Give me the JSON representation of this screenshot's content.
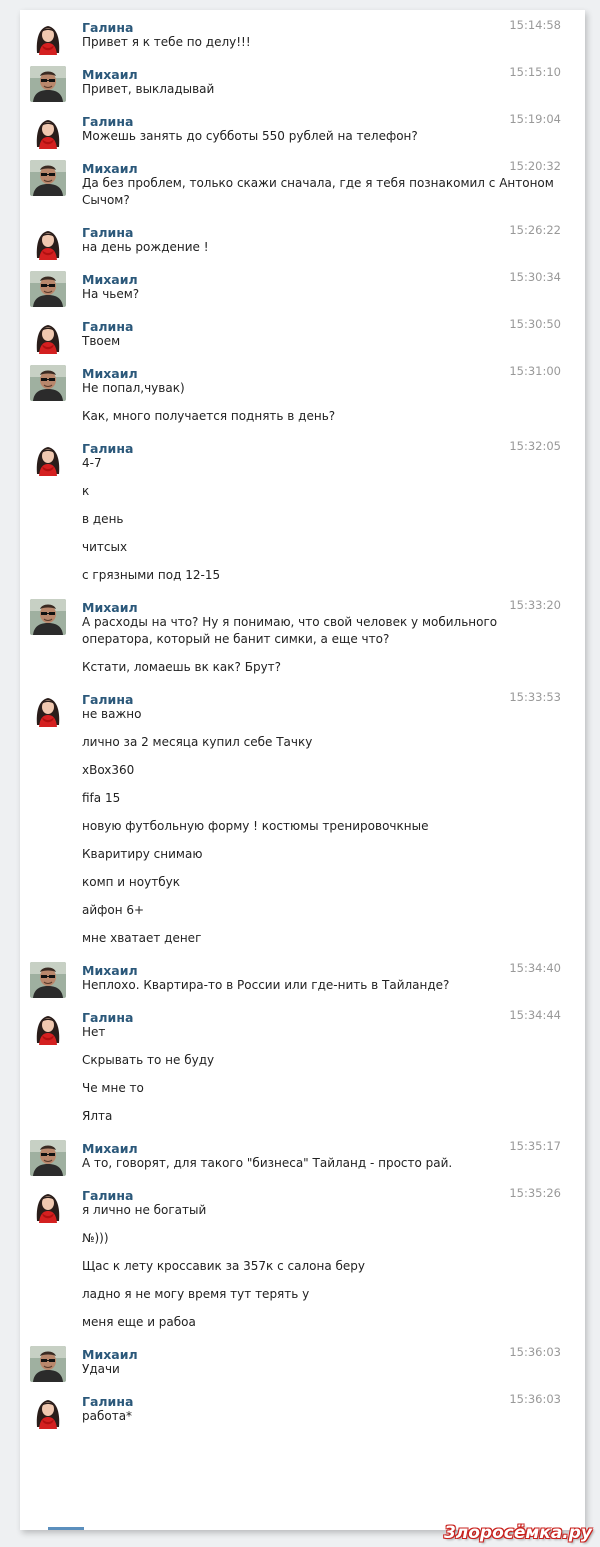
{
  "watermark": "3лорoсёмка.ру",
  "messages": [
    {
      "author": "Галина",
      "avatar": "galina",
      "time": "15:14:58",
      "lines": [
        "Привет я к тебе по делу!!!"
      ]
    },
    {
      "author": "Михаил",
      "avatar": "mikhail",
      "time": "15:15:10",
      "lines": [
        "Привет, выкладывай"
      ]
    },
    {
      "author": "Галина",
      "avatar": "galina",
      "time": "15:19:04",
      "lines": [
        "Можешь занять до субботы 550 рублей на телефон?"
      ]
    },
    {
      "author": "Михаил",
      "avatar": "mikhail",
      "time": "15:20:32",
      "lines": [
        "Да без проблем, только скажи сначала, где я тебя познакомил с Антоном Сычом?"
      ]
    },
    {
      "author": "Галина",
      "avatar": "galina",
      "time": "15:26:22",
      "lines": [
        "на день рождение !"
      ]
    },
    {
      "author": "Михаил",
      "avatar": "mikhail",
      "time": "15:30:34",
      "lines": [
        "На чьем?"
      ]
    },
    {
      "author": "Галина",
      "avatar": "galina",
      "time": "15:30:50",
      "lines": [
        "Твоем"
      ]
    },
    {
      "author": "Михаил",
      "avatar": "mikhail",
      "time": "15:31:00",
      "lines": [
        "Не попал,чувак)",
        "Как, много получается поднять в день?"
      ]
    },
    {
      "author": "Галина",
      "avatar": "galina",
      "time": "15:32:05",
      "lines": [
        "4-7",
        "к",
        "в день",
        "читсых",
        "с грязными под 12-15"
      ]
    },
    {
      "author": "Михаил",
      "avatar": "mikhail",
      "time": "15:33:20",
      "lines": [
        "А расходы на что? Ну я понимаю, что свой человек у мобильного оператора, который не банит симки, а еще что?",
        "Кстати, ломаешь вк как? Брут?"
      ]
    },
    {
      "author": "Галина",
      "avatar": "galina",
      "time": "15:33:53",
      "lines": [
        "не важно",
        "лично за 2 месяца купил себе Тачку",
        "xBox360",
        "fifa 15",
        "новую футбольную форму ! костюмы тренировочкные",
        "Кваритиру снимаю",
        "комп и ноутбук",
        "айфон 6+",
        "мне хватает денег"
      ]
    },
    {
      "author": "Михаил",
      "avatar": "mikhail",
      "time": "15:34:40",
      "lines": [
        "Неплохо. Квартира-то в России или где-нить в Тайланде?"
      ]
    },
    {
      "author": "Галина",
      "avatar": "galina",
      "time": "15:34:44",
      "lines": [
        "Нет",
        "Скрывать то не буду",
        "Че мне то",
        "Ялта"
      ]
    },
    {
      "author": "Михаил",
      "avatar": "mikhail",
      "time": "15:35:17",
      "lines": [
        "А то, говорят, для такого \"бизнеса\" Тайланд - просто рай."
      ]
    },
    {
      "author": "Галина",
      "avatar": "galina",
      "time": "15:35:26",
      "lines": [
        "я лично не богатый",
        "№)))",
        "Щас к лету кроссавик за 357к с салона беру",
        "ладно я не могу время тут терять у",
        "меня еще и рабоа"
      ]
    },
    {
      "author": "Михаил",
      "avatar": "mikhail",
      "time": "15:36:03",
      "lines": [
        "Удачи"
      ]
    },
    {
      "author": "Галина",
      "avatar": "galina",
      "time": "15:36:03",
      "lines": [
        "работа*"
      ]
    }
  ]
}
